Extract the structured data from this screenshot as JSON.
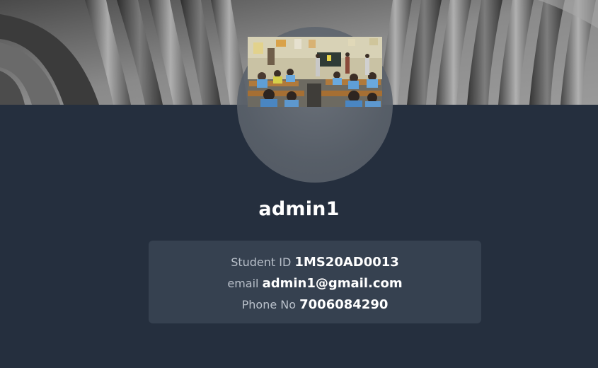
{
  "profile": {
    "username": "admin1",
    "fields": [
      {
        "label": "Student ID",
        "value": "1MS20AD0013"
      },
      {
        "label": "email",
        "value": "admin1@gmail.com"
      },
      {
        "label": "Phone No",
        "value": "7006084290"
      }
    ]
  },
  "colors": {
    "page_background": "#252f3e",
    "card_background": "#364150",
    "label_text": "#b9c0ca",
    "value_text": "#ffffff"
  },
  "images": {
    "cover": "abstract-grey-folds-image",
    "avatar": "classroom-photo"
  }
}
